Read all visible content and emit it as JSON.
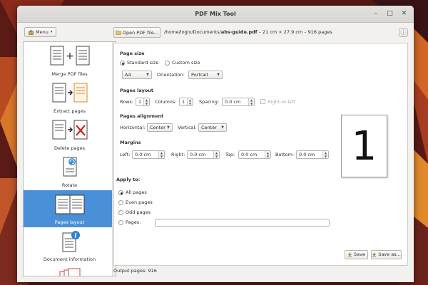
{
  "window": {
    "title": "PDF Mix Tool"
  },
  "menu": {
    "label": "Menu"
  },
  "tools": [
    {
      "label": "Merge PDF files",
      "icon": "merge-pdf-icon"
    },
    {
      "label": "Extract pages",
      "icon": "extract-pages-icon"
    },
    {
      "label": "Delete pages",
      "icon": "delete-pages-icon"
    },
    {
      "label": "Rotate",
      "icon": "rotate-icon"
    },
    {
      "label": "Pages layout",
      "icon": "pages-layout-icon",
      "selected": true
    },
    {
      "label": "Document information",
      "icon": "document-info-icon"
    }
  ],
  "toolbar": {
    "open_label": "Open PDF file...",
    "path_prefix": "/home/logix/Documents/",
    "file_name": "abs-guide.pdf",
    "file_info": " – 21 cm × 27.9 cm – 916 pages"
  },
  "page_size": {
    "heading": "Page size",
    "standard_label": "Standard size",
    "custom_label": "Custom size",
    "selected": "standard",
    "size_value": "A4",
    "orientation_label": "Orientation:",
    "orientation_value": "Portrait"
  },
  "pages_layout": {
    "heading": "Pages layout",
    "rows_label": "Rows:",
    "rows_value": "1",
    "columns_label": "Columns:",
    "columns_value": "1",
    "spacing_label": "Spacing:",
    "spacing_value": "0.0 cm",
    "rtl_label": "Right-to-left",
    "rtl_checked": false
  },
  "alignment": {
    "heading": "Pages alignment",
    "horizontal_label": "Horizontal:",
    "horizontal_value": "Center",
    "vertical_label": "Vertical:",
    "vertical_value": "Center"
  },
  "margins": {
    "heading": "Margins",
    "left_label": "Left:",
    "left_value": "0.0 cm",
    "right_label": "Right:",
    "right_value": "0.0 cm",
    "top_label": "Top:",
    "top_value": "0.0 cm",
    "bottom_label": "Bottom:",
    "bottom_value": "0.0 cm"
  },
  "apply_to": {
    "heading": "Apply to:",
    "all_label": "All pages",
    "even_label": "Even pages",
    "odd_label": "Odd pages",
    "pages_label": "Pages:",
    "pages_value": "",
    "selected": "all"
  },
  "preview": {
    "page_number": "1"
  },
  "actions": {
    "save_label": "Save",
    "save_as_label": "Save as..."
  },
  "status": {
    "text": "Output pages: 916"
  }
}
